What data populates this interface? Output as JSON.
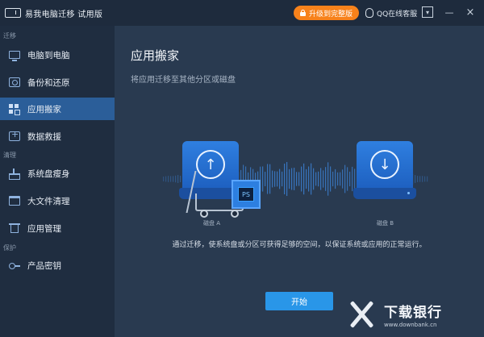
{
  "titlebar": {
    "title": "易我电脑迁移 试用版",
    "upgrade_label": "升级到完整版",
    "qq_label": "QQ在线客服",
    "down_icon": "▾",
    "minimize_icon": "—",
    "close_icon": "×"
  },
  "sidebar": {
    "sections": [
      {
        "label": "迁移"
      },
      {
        "label": "清理"
      },
      {
        "label": "保护"
      }
    ],
    "items": [
      {
        "label": "电脑到电脑",
        "icon": "monitor-icon"
      },
      {
        "label": "备份和还原",
        "icon": "backup-icon"
      },
      {
        "label": "应用搬家",
        "icon": "apps-icon",
        "active": true
      },
      {
        "label": "数据救援",
        "icon": "rescue-icon"
      },
      {
        "label": "系统盘瘦身",
        "icon": "broom-icon"
      },
      {
        "label": "大文件清理",
        "icon": "folder-icon"
      },
      {
        "label": "应用管理",
        "icon": "trash-icon"
      },
      {
        "label": "产品密钥",
        "icon": "key-icon"
      }
    ]
  },
  "main": {
    "title": "应用搬家",
    "subtitle": "将应用迁移至其他分区或磁盘",
    "disk_a_label": "磁盘 A",
    "disk_b_label": "磁盘 B",
    "upload_arrow": "↑",
    "download_arrow": "↓",
    "app_badge": "PS",
    "description": "通过迁移，使系统盘或分区可获得足够的空间，以保证系统或应用的正常运行。",
    "start_label": "开始"
  },
  "watermark": {
    "title": "下载银行",
    "url": "www.downbank.cn"
  },
  "colors": {
    "sidebar_bg": "#1f2d40",
    "main_bg": "#293a50",
    "active_item": "#2b5e99",
    "upgrade_orange": "#f7821b",
    "start_blue": "#2996e8",
    "disk_blue": "#2f7fe0"
  }
}
